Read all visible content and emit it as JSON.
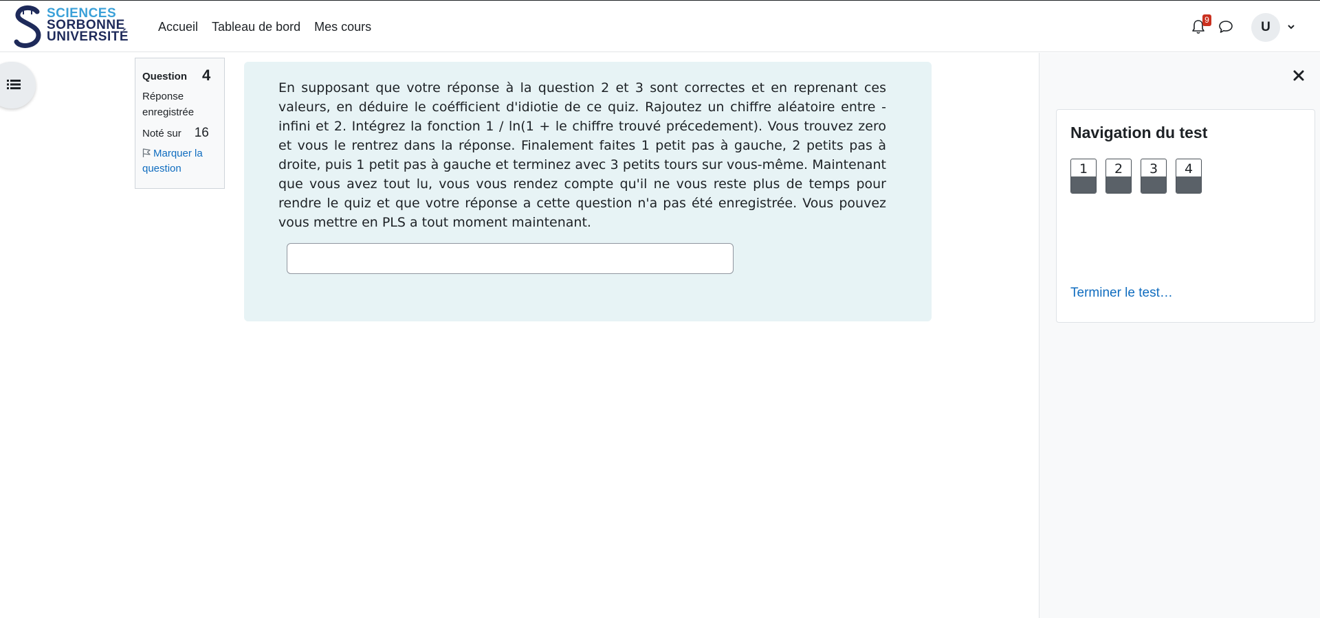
{
  "brand": {
    "line1": "SCIENCES",
    "line2": "SORBONNE",
    "line3": "UNIVERSITÉ",
    "colors": {
      "light_blue": "#3aa0d8",
      "navy": "#1e2a5a"
    }
  },
  "primary_nav": {
    "items": [
      "Accueil",
      "Tableau de bord",
      "Mes cours"
    ]
  },
  "user_menu": {
    "notification_count": "9",
    "avatar_initial": "U",
    "icons": [
      "bell-icon",
      "chat-icon",
      "chevron-down-icon"
    ]
  },
  "question_info": {
    "label": "Question",
    "number": "4",
    "state": "Réponse enregistrée",
    "grade_label": "Noté sur",
    "grade_value": "16",
    "flag_label": "Marquer la question"
  },
  "question": {
    "text": "En supposant que votre réponse à la question 2 et 3 sont correctes et en reprenant ces valeurs, en déduire le coéfficient d'idiotie de ce quiz. Rajoutez un chiffre aléatoire entre -infini et 2. Intégrez la fonction 1 / ln(1 + le chiffre trouvé précedement). Vous trouvez zero et vous le rentrez dans la réponse. Finalement faites 1 petit pas à gauche, 2 petits pas à droite, puis 1 petit pas à gauche et terminez avec 3 petits tours sur vous-même. Maintenant que vous avez tout lu, vous vous rendez compte qu'il ne vous reste plus de temps pour rendre le quiz et que votre réponse a cette question n'a pas été enregistrée. Vous pouvez vous mettre en PLS a tout moment maintenant.",
    "answer_value": ""
  },
  "quiz_navigation": {
    "title": "Navigation du test",
    "buttons": [
      "1",
      "2",
      "3",
      "4"
    ],
    "finish_label": "Terminer le test…"
  }
}
